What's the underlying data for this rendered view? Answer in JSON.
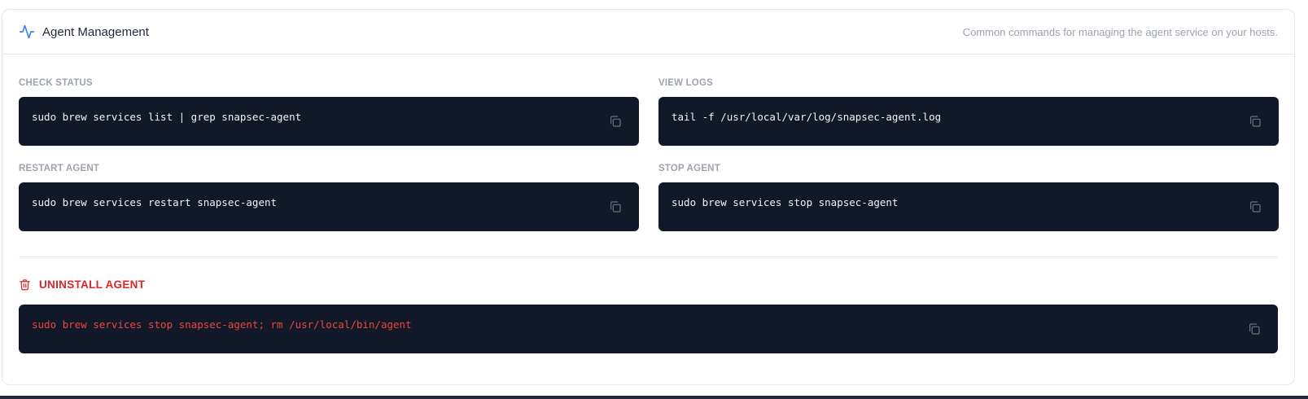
{
  "header": {
    "title": "Agent Management",
    "subtitle": "Common commands for managing the agent service on your hosts.",
    "icon": "activity-icon",
    "accent_color": "#3b82f6"
  },
  "commands": [
    {
      "label": "CHECK STATUS",
      "command": "sudo brew services list | grep snapsec-agent"
    },
    {
      "label": "VIEW LOGS",
      "command": "tail -f /usr/local/var/log/snapsec-agent.log"
    },
    {
      "label": "RESTART AGENT",
      "command": "sudo brew services restart snapsec-agent"
    },
    {
      "label": "STOP AGENT",
      "command": "sudo brew services stop snapsec-agent"
    }
  ],
  "uninstall": {
    "label": "UNINSTALL AGENT",
    "icon": "trash-icon",
    "command": "sudo brew services stop snapsec-agent; rm /usr/local/bin/agent",
    "color": "#dc2626"
  },
  "copy_icon": "copy-icon",
  "code_bg": "#111827"
}
